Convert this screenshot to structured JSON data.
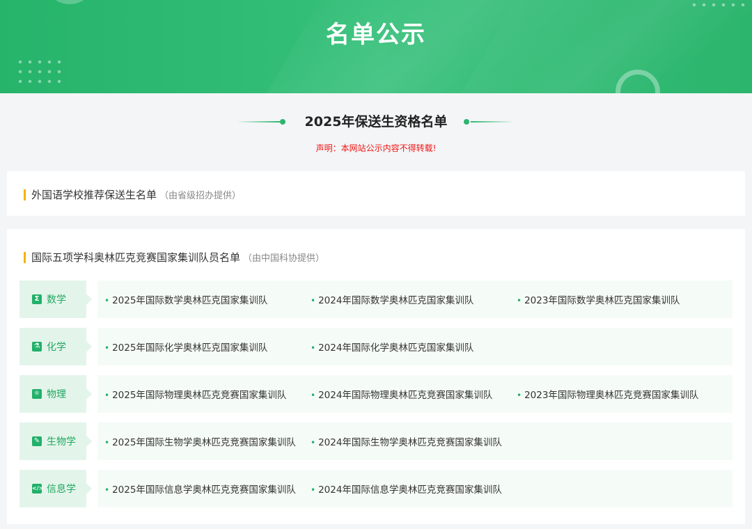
{
  "banner": {
    "title": "名单公示"
  },
  "section": {
    "title": "2025年保送生资格名单",
    "notice": "声明：本网站公示内容不得转载!"
  },
  "card1": {
    "title": "外国语学校推荐保送生名单",
    "note": "（由省级招办提供）"
  },
  "card2": {
    "title": "国际五项学科奥林匹克竞赛国家集训队员名单",
    "note": "（由中国科协提供）",
    "subjects": [
      {
        "name": "数学",
        "icon": "sigma-icon",
        "links": [
          "2025年国际数学奥林匹克国家集训队",
          "2024年国际数学奥林匹克国家集训队",
          "2023年国际数学奥林匹克国家集训队"
        ]
      },
      {
        "name": "化学",
        "icon": "flask-icon",
        "links": [
          "2025年国际化学奥林匹克国家集训队",
          "2024年国际化学奥林匹克国家集训队"
        ]
      },
      {
        "name": "物理",
        "icon": "atom-icon",
        "links": [
          "2025年国际物理奥林匹克竞赛国家集训队",
          "2024年国际物理奥林匹克竞赛国家集训队",
          "2023年国际物理奥林匹克竞赛国家集训队"
        ]
      },
      {
        "name": "生物学",
        "icon": "leaf-icon",
        "links": [
          "2025年国际生物学奥林匹克竞赛国家集训队",
          "2024年国际生物学奥林匹克竞赛国家集训队"
        ]
      },
      {
        "name": "信息学",
        "icon": "code-icon",
        "links": [
          "2025年国际信息学奥林匹克竞赛国家集训队",
          "2024年国际信息学奥林匹克竞赛国家集训队"
        ]
      }
    ]
  },
  "colors": {
    "accent": "#2cb56d",
    "notice": "#f01414",
    "bar": "#f4b400"
  }
}
